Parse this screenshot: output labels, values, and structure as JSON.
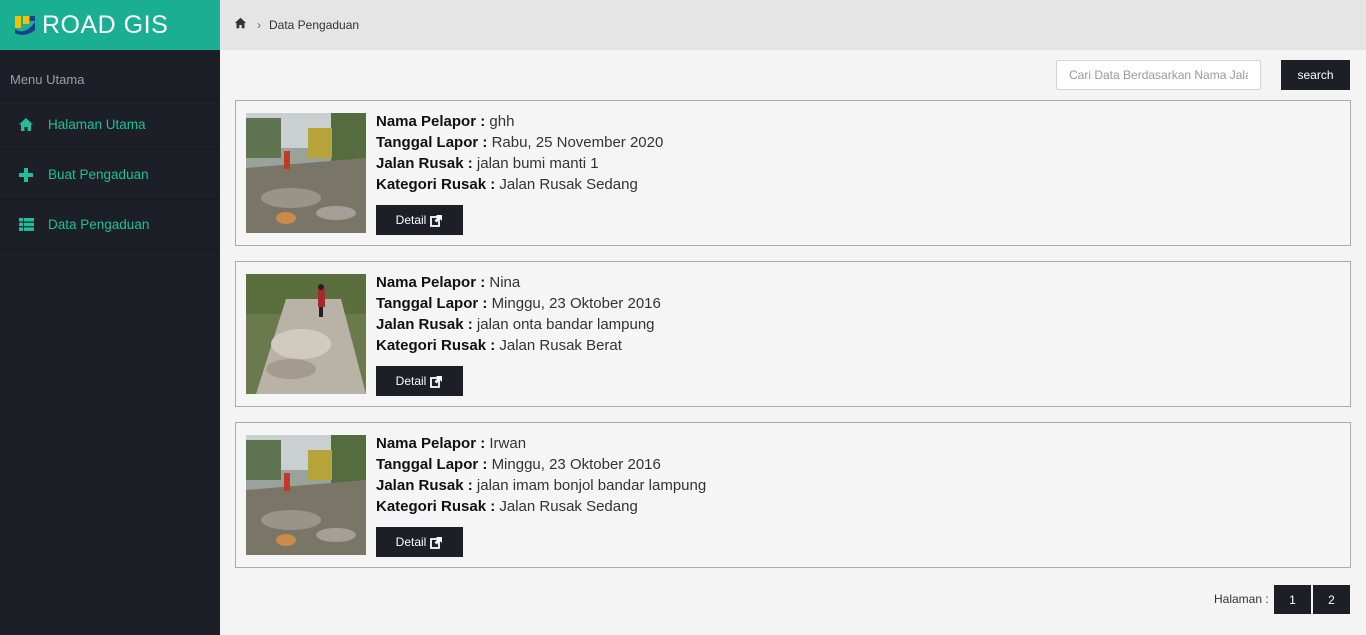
{
  "app": {
    "title": "ROAD GIS"
  },
  "sidebar": {
    "menu_header": "Menu Utama",
    "items": [
      {
        "label": "Halaman Utama",
        "icon": "home-icon"
      },
      {
        "label": "Buat Pengaduan",
        "icon": "plus-icon"
      },
      {
        "label": "Data Pengaduan",
        "icon": "list-icon"
      }
    ]
  },
  "breadcrumb": {
    "current": "Data Pengaduan"
  },
  "search": {
    "placeholder": "Cari Data Berdasarkan Nama Jalan",
    "button_label": "search"
  },
  "field_labels": {
    "pelapor": "Nama Pelapor :",
    "tanggal": "Tanggal Lapor :",
    "jalan": "Jalan Rusak :",
    "kategori": "Kategori Rusak :"
  },
  "reports": [
    {
      "pelapor": "ghh",
      "tanggal": "Rabu, 25 November 2020",
      "jalan": "jalan bumi manti 1",
      "kategori": "Jalan Rusak Sedang",
      "detail_label": "Detail"
    },
    {
      "pelapor": "Nina",
      "tanggal": "Minggu, 23 Oktober 2016",
      "jalan": "jalan onta bandar lampung",
      "kategori": "Jalan Rusak Berat",
      "detail_label": "Detail"
    },
    {
      "pelapor": "Irwan",
      "tanggal": "Minggu, 23 Oktober 2016",
      "jalan": "jalan imam bonjol bandar lampung",
      "kategori": "Jalan Rusak Sedang",
      "detail_label": "Detail"
    }
  ],
  "pagination": {
    "label": "Halaman :",
    "pages": [
      "1",
      "2"
    ]
  },
  "colors": {
    "accent": "#1aaf93",
    "sidebar_bg": "#1c1f26",
    "menu_text": "#1fbf9c"
  }
}
